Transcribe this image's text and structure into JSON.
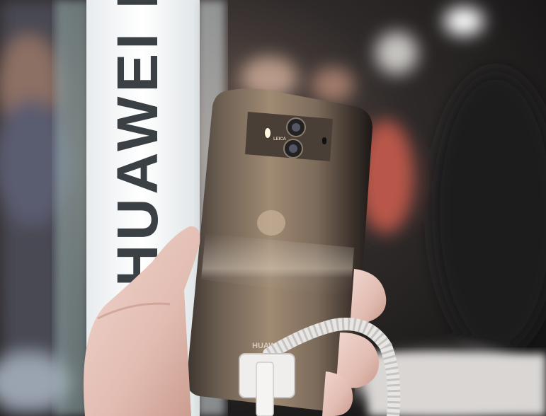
{
  "scene": {
    "banner": {
      "text": "HUAWEI Ma"
    },
    "phone": {
      "camera_brand": "LEICA",
      "brand": "HUAWEI"
    }
  }
}
